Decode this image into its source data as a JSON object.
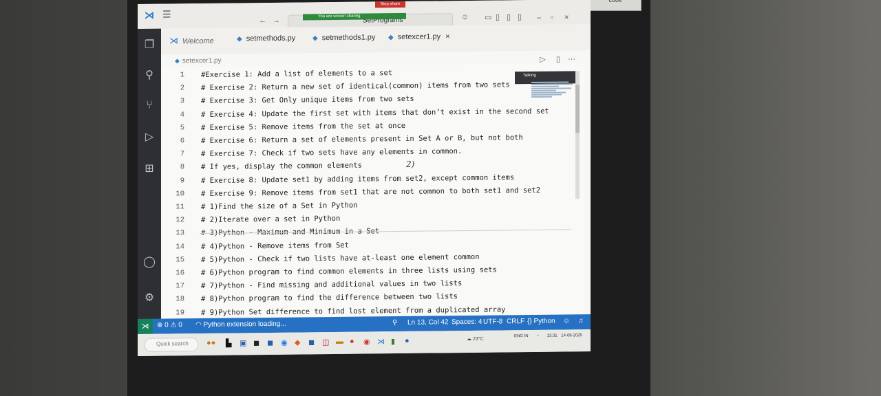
{
  "titlebar": {
    "search_text": "SetPrograms",
    "sharing_notice": "You are screen sharing",
    "stop_share": "Stop share"
  },
  "tabs": [
    {
      "label": "Welcome",
      "icon": "vscode-logo-icon"
    },
    {
      "label": "setmethods.py",
      "icon": "python-file-icon"
    },
    {
      "label": "setmethods1.py",
      "icon": "python-file-icon"
    },
    {
      "label": "setexcer1.py",
      "icon": "python-file-icon",
      "active": true
    }
  ],
  "tab_close": "×",
  "breadcrumb": "setexcer1.py",
  "editor": {
    "lines": [
      {
        "n": "1",
        "text": "#Exercise 1: Add a list of elements to a set"
      },
      {
        "n": "2",
        "text": "# Exercise 2: Return a new set of identical(common) items from two sets"
      },
      {
        "n": "3",
        "text": "# Exercise 3: Get Only unique items from two sets"
      },
      {
        "n": "4",
        "text": "# Exercise 4: Update the first set with items that don’t exist in the second set"
      },
      {
        "n": "5",
        "text": "# Exercise 5: Remove items from the set at once"
      },
      {
        "n": "6",
        "text": "# Exercise 6: Return a set of elements present in Set A or B, but not both"
      },
      {
        "n": "7",
        "text": "# Exercise 7: Check if two sets have any elements in common."
      },
      {
        "n": "8",
        "text": "# If yes, display the common elements"
      },
      {
        "n": "9",
        "text": "# Exercise 8: Update set1 by adding items from set2, except common items"
      },
      {
        "n": "10",
        "text": "# Exercise 9: Remove items from set1 that are not common to both set1 and set2"
      },
      {
        "n": "11",
        "text": "# 1)Find the size of a Set in Python"
      },
      {
        "n": "12",
        "text": "# 2)Iterate over a set in Python"
      },
      {
        "n": "13",
        "text": "# 3)Python - Maximum and Minimum in a Set"
      },
      {
        "n": "14",
        "text": "# 4)Python - Remove items from Set"
      },
      {
        "n": "15",
        "text": "# 5)Python - Check if two lists have at-least one element common"
      },
      {
        "n": "16",
        "text": "# 6)Python program to find common elements in three lists using sets"
      },
      {
        "n": "17",
        "text": "# 7)Python - Find missing and additional values in two lists"
      },
      {
        "n": "18",
        "text": "# 8)Python program to find the difference between two lists"
      },
      {
        "n": "19",
        "text": "# 9)Python Set difference to find lost element from a duplicated array"
      }
    ]
  },
  "handwritten_annotation": "2)",
  "tooltip": "Talking",
  "statusbar": {
    "problems": "⊗ 0 ⚠ 0",
    "extension": "Python extension loading...",
    "position": "Ln 13, Col 42",
    "spaces": "Spaces: 4",
    "encoding": "UTF-8",
    "eol": "CRLF",
    "language": "{} Python"
  },
  "taskbar": {
    "search_placeholder": "Quick search",
    "weather": "23°C",
    "language": "ENG IN",
    "time": "13:31",
    "date": "14-08-2025"
  },
  "colors": {
    "statusbar": "#2771c4",
    "activitybar": "#2e2f33",
    "editor_bg": "#f9f9f7"
  },
  "projector_label": "cooli"
}
